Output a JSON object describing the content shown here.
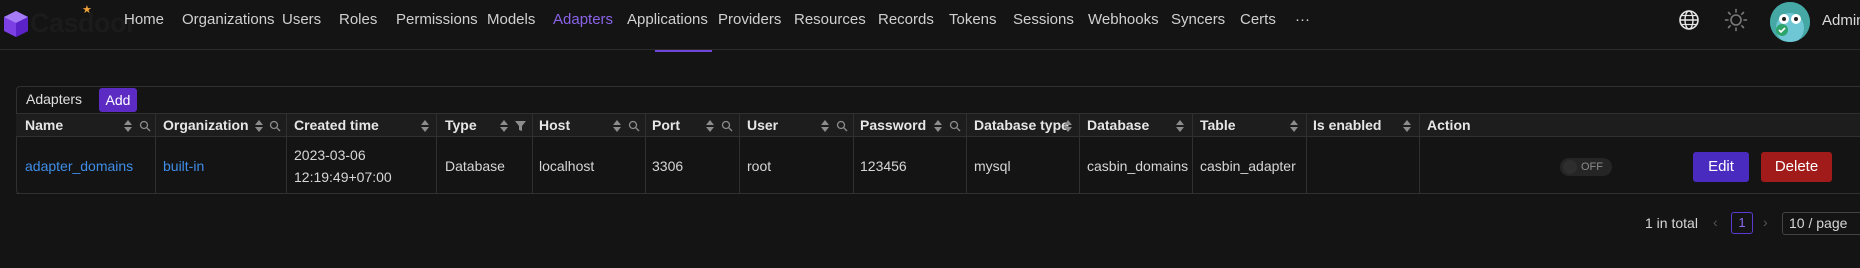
{
  "app": {
    "logo_text": "Casdoor"
  },
  "nav": {
    "items": [
      {
        "label": "Home"
      },
      {
        "label": "Organizations"
      },
      {
        "label": "Users"
      },
      {
        "label": "Roles"
      },
      {
        "label": "Permissions"
      },
      {
        "label": "Models"
      },
      {
        "label": "Adapters"
      },
      {
        "label": "Applications"
      },
      {
        "label": "Providers"
      },
      {
        "label": "Resources"
      },
      {
        "label": "Records"
      },
      {
        "label": "Tokens"
      },
      {
        "label": "Sessions"
      },
      {
        "label": "Webhooks"
      },
      {
        "label": "Syncers"
      },
      {
        "label": "Certs"
      },
      {
        "label": "···"
      }
    ],
    "active": "Adapters"
  },
  "header_right": {
    "user_name": "Admin",
    "icons": [
      "globe-icon",
      "sun-icon",
      "avatar"
    ]
  },
  "card": {
    "title": "Adapters",
    "add_label": "Add"
  },
  "table": {
    "columns": [
      "Name",
      "Organization",
      "Created time",
      "Type",
      "Host",
      "Port",
      "User",
      "Password",
      "Database type",
      "Database",
      "Table",
      "Is enabled",
      "Action"
    ],
    "rows": [
      {
        "name": "adapter_domains",
        "organization": "built-in",
        "created_date": "2023-03-06",
        "created_time": "12:19:49+07:00",
        "type": "Database",
        "host": "localhost",
        "port": "3306",
        "user": "root",
        "password": "123456",
        "database_type": "mysql",
        "database": "casbin_domains",
        "table": "casbin_adapter",
        "is_enabled": "OFF",
        "edit_label": "Edit",
        "delete_label": "Delete"
      }
    ]
  },
  "pagination": {
    "total_text": "1 in total",
    "current_page": "1",
    "page_size": "10 / page"
  },
  "colors": {
    "accent": "#6e45d6",
    "link": "#3f8de8",
    "danger": "#a11b1b",
    "background": "#141414"
  }
}
